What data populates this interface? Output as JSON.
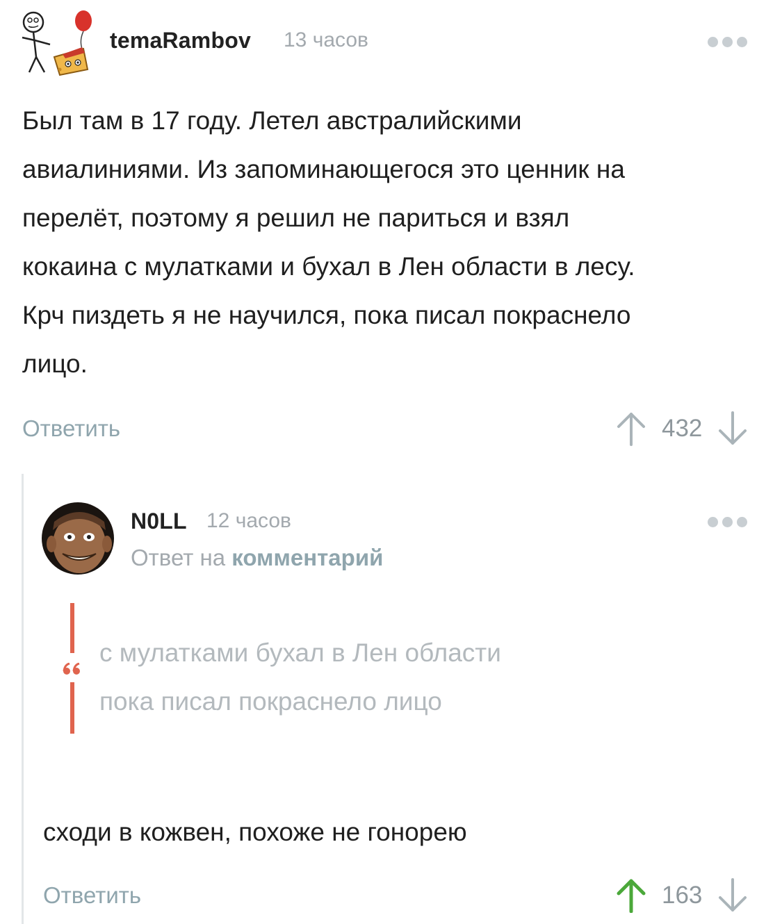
{
  "comment": {
    "author": "temaRambov",
    "time": "13 часов",
    "text_lines": [
      "Был там в 17 году. Летел австралийскими",
      "авиалиниями. Из запоминающегося это ценник на",
      "перелёт, поэтому я решил не париться и взял",
      "кокаина с мулатками и бухал в Лен области в лесу.",
      "Крч пиздеть я не научился, пока писал покраснело",
      "лицо."
    ],
    "reply_label": "Ответить",
    "votes": "432"
  },
  "reply": {
    "author": "N0LL",
    "time": "12 часов",
    "reply_to_prefix": "Ответ на ",
    "reply_to_link": "комментарий",
    "quote_lines": [
      "с мулатками бухал в Лен области",
      "пока писал покраснело лицо"
    ],
    "text": "сходи в кожвен, похоже не гонорею",
    "reply_label": "Ответить",
    "votes": "163"
  },
  "colors": {
    "link": "#8fa5ad",
    "quote_bar": "#e0644e",
    "upvote_active": "#4ba83a",
    "icon_gray": "#aab4b9"
  },
  "icons": [
    "more-dots-icon",
    "arrow-up-icon",
    "arrow-down-icon",
    "quote-icon"
  ]
}
